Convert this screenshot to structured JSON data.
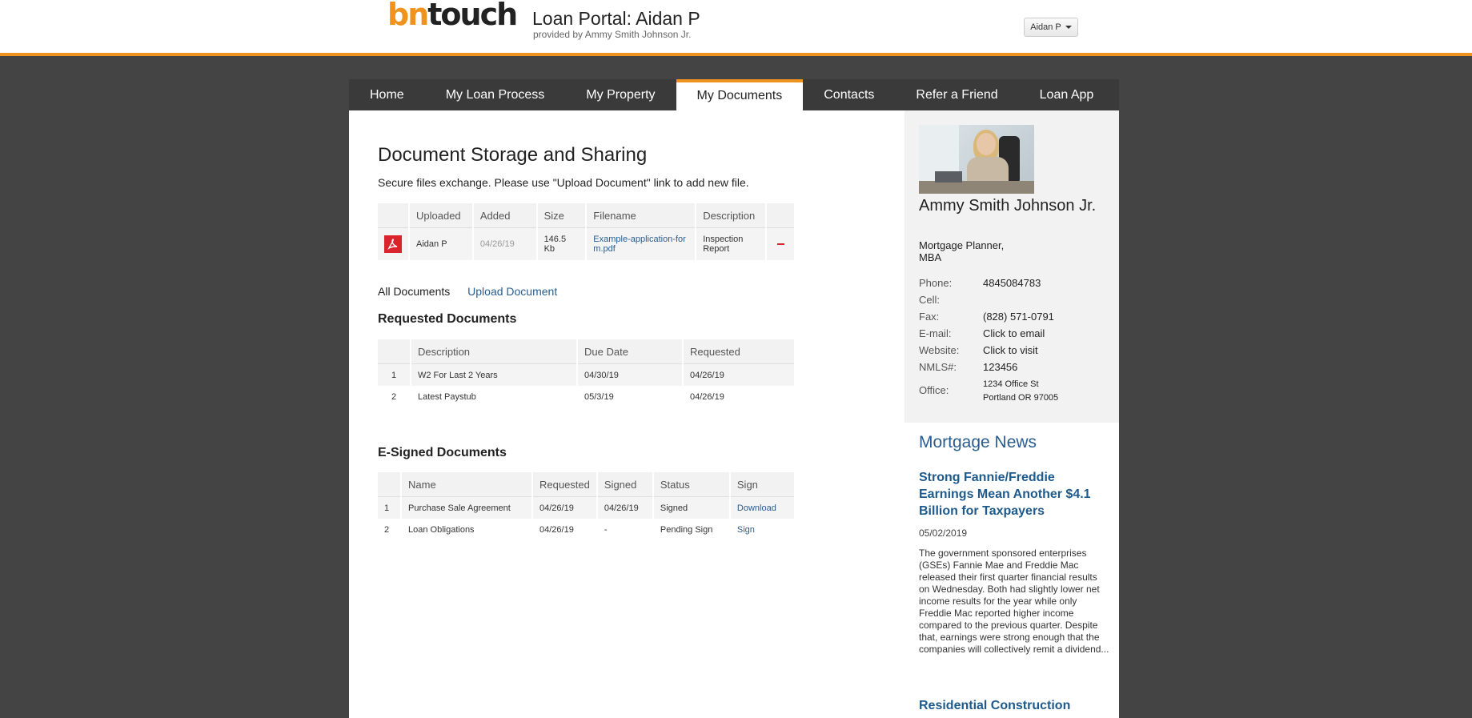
{
  "brand": {
    "logo_bn": "bn",
    "logo_touch": "touch"
  },
  "header": {
    "title": "Loan Portal: Aidan P",
    "subtitle": "provided by Ammy Smith Johnson Jr.",
    "user_menu": "Aidan P"
  },
  "nav": {
    "tabs": [
      {
        "label": "Home"
      },
      {
        "label": "My Loan Process"
      },
      {
        "label": "My Property"
      },
      {
        "label": "My Documents",
        "active": true
      },
      {
        "label": "Contacts"
      },
      {
        "label": "Refer a Friend"
      },
      {
        "label": "Loan App"
      }
    ]
  },
  "documents": {
    "heading": "Document Storage and Sharing",
    "intro": "Secure files exchange. Please use \"Upload Document\" link to add new file.",
    "columns": [
      "",
      "Uploaded",
      "Added",
      "Size",
      "Filename",
      "Description",
      ""
    ],
    "rows": [
      {
        "icon": "pdf-icon",
        "uploaded": "Aidan P",
        "added": "04/26/19",
        "size": "146.5 Kb",
        "filename": "Example-application-form.pdf",
        "description": "Inspection Report"
      }
    ],
    "links": {
      "all": "All Documents",
      "upload": "Upload Document"
    }
  },
  "requested": {
    "heading": "Requested Documents",
    "columns": [
      "",
      "Description",
      "Due Date",
      "Requested"
    ],
    "rows": [
      {
        "n": "1",
        "description": "W2 For Last 2 Years",
        "due": "04/30/19",
        "requested": "04/26/19"
      },
      {
        "n": "2",
        "description": "Latest Paystub",
        "due": "05/3/19",
        "requested": "04/26/19"
      }
    ]
  },
  "esigned": {
    "heading": "E-Signed Documents",
    "columns": [
      "",
      "Name",
      "Requested",
      "Signed",
      "Status",
      "Sign"
    ],
    "rows": [
      {
        "n": "1",
        "name": "Purchase Sale Agreement",
        "requested": "04/26/19",
        "signed": "04/26/19",
        "status": "Signed",
        "action": "Download"
      },
      {
        "n": "2",
        "name": "Loan Obligations",
        "requested": "04/26/19",
        "signed": "-",
        "status": "Pending Sign",
        "action": "Sign"
      }
    ]
  },
  "officer": {
    "name": "Ammy Smith Johnson Jr.",
    "title": "Mortgage Planner, MBA",
    "labels": {
      "phone": "Phone:",
      "cell": "Cell:",
      "fax": "Fax:",
      "email": "E-mail:",
      "website": "Website:",
      "nmls": "NMLS#:",
      "office": "Office:"
    },
    "phone": "4845084783",
    "cell": "",
    "fax": "(828) 571-0791",
    "email": "Click to email",
    "website": "Click to visit",
    "nmls": "123456",
    "office_line1": "1234 Office St",
    "office_line2": "Portland OR 97005"
  },
  "news": {
    "heading": "Mortgage News",
    "title": "Strong Fannie/Freddie Earnings Mean Another $4.1 Billion for Taxpayers",
    "date": "05/02/2019",
    "body": "The government sponsored enterprises (GSEs) Fannie Mae and Freddie Mac released their first quarter financial results on Wednesday.  Both had slightly lower net income results for the year while only Freddie Mac reported higher income compared to the previous quarter.  Despite that, earnings were strong enough that the companies will collectively remit a dividend...",
    "next_title": "Residential Construction"
  },
  "colors": {
    "accent": "#f0931e",
    "link": "#2a5d8f",
    "pdf": "#d9232d",
    "background": "#444444"
  }
}
